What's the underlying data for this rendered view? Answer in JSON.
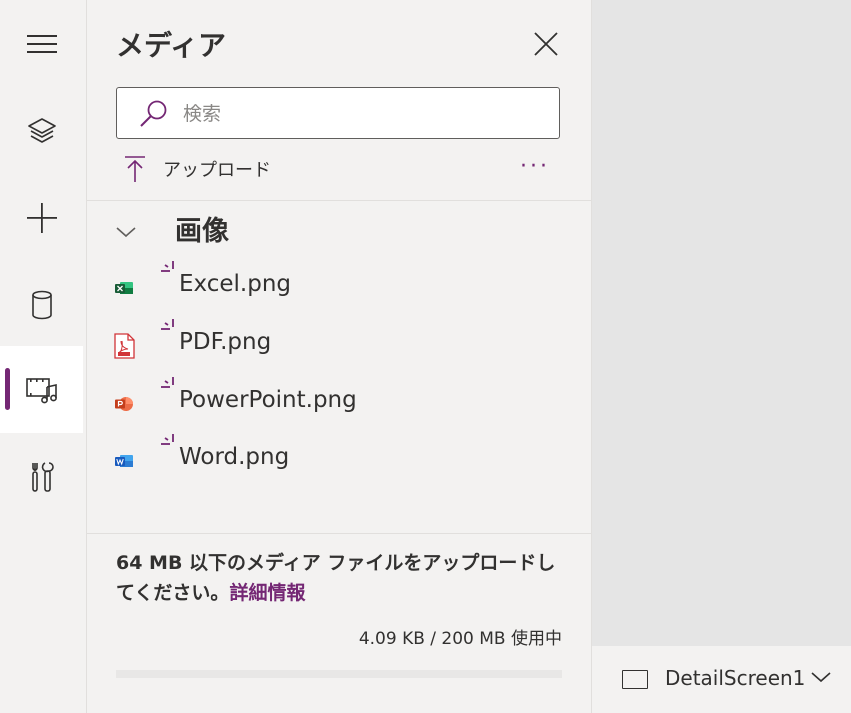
{
  "rail": {
    "items": [
      {
        "icon": "hamburger-menu-icon"
      },
      {
        "icon": "layers-icon"
      },
      {
        "icon": "plus-icon"
      },
      {
        "icon": "database-icon"
      },
      {
        "icon": "media-icon",
        "active": true
      },
      {
        "icon": "tools-icon"
      }
    ]
  },
  "panel": {
    "title": "メディア",
    "search": {
      "placeholder": "検索",
      "value": ""
    },
    "upload_label": "アップロード",
    "more_label": "···",
    "section_title": "画像",
    "files": [
      {
        "name": "Excel.png",
        "icon": "excel-file-icon",
        "color": "#217346"
      },
      {
        "name": "PDF.png",
        "icon": "pdf-file-icon",
        "color": "#d13438"
      },
      {
        "name": "PowerPoint.png",
        "icon": "powerpoint-file-icon",
        "color": "#d24726"
      },
      {
        "name": "Word.png",
        "icon": "word-file-icon",
        "color": "#2b579a"
      }
    ],
    "info_text": "64 MB 以下のメディア ファイルをアップロードしてください。",
    "info_link": "詳細情報",
    "usage_text": "4.09 KB / 200 MB 使用中",
    "usage_fraction": 2e-05
  },
  "statusbar": {
    "screen_name": "DetailScreen1"
  },
  "colors": {
    "accent": "#742774",
    "text": "#323130",
    "background": "#f3f2f1"
  }
}
